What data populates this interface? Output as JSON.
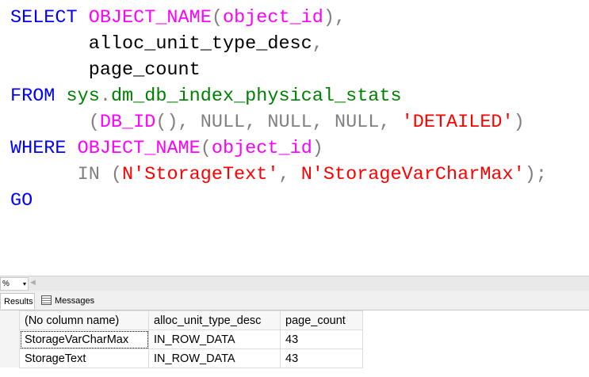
{
  "editor": {
    "lines": [
      [
        {
          "t": "SELECT ",
          "c": "kw"
        },
        {
          "t": "OBJECT_NAME",
          "c": "fn"
        },
        {
          "t": "(",
          "c": "gr"
        },
        {
          "t": "object_id",
          "c": "fn"
        },
        {
          "t": "),",
          "c": "gr"
        }
      ],
      [
        {
          "t": "       alloc_unit_type_desc",
          "c": "id"
        },
        {
          "t": ",",
          "c": "gr"
        }
      ],
      [
        {
          "t": "       page_count",
          "c": "id"
        }
      ],
      [
        {
          "t": "FROM ",
          "c": "kw"
        },
        {
          "t": "sys",
          "c": "sys"
        },
        {
          "t": ".",
          "c": "gr"
        },
        {
          "t": "dm_db_index_physical_stats",
          "c": "sys"
        }
      ],
      [
        {
          "t": "       (",
          "c": "gr"
        },
        {
          "t": "DB_ID",
          "c": "fn"
        },
        {
          "t": "(), NULL, NULL, NULL, ",
          "c": "gr"
        },
        {
          "t": "'DETAILED'",
          "c": "str"
        },
        {
          "t": ")",
          "c": "gr"
        }
      ],
      [
        {
          "t": "WHERE ",
          "c": "kw"
        },
        {
          "t": "OBJECT_NAME",
          "c": "fn"
        },
        {
          "t": "(",
          "c": "gr"
        },
        {
          "t": "object_id",
          "c": "fn"
        },
        {
          "t": ")",
          "c": "gr"
        }
      ],
      [
        {
          "t": "      IN (",
          "c": "gr"
        },
        {
          "t": "N'StorageText'",
          "c": "str"
        },
        {
          "t": ", ",
          "c": "gr"
        },
        {
          "t": "N'StorageVarCharMax'",
          "c": "str"
        },
        {
          "t": ");",
          "c": "gr"
        }
      ],
      [
        {
          "t": "GO",
          "c": "kw"
        }
      ]
    ]
  },
  "zoom": {
    "value": "%",
    "dropdown": "▾",
    "scroll_left": "◀"
  },
  "tabs": {
    "results": "Results",
    "messages": "Messages"
  },
  "results": {
    "columns": [
      "(No column name)",
      "alloc_unit_type_desc",
      "page_count"
    ],
    "rows": [
      [
        "StorageVarCharMax",
        "IN_ROW_DATA",
        "43"
      ],
      [
        "StorageText",
        "IN_ROW_DATA",
        "43"
      ]
    ]
  }
}
